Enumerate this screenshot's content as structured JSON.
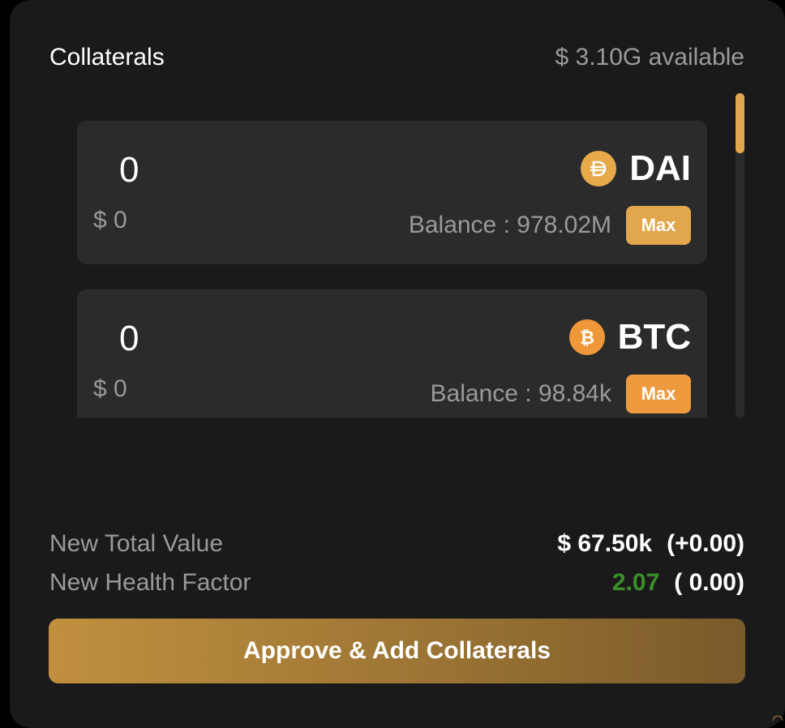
{
  "header": {
    "title": "Collaterals",
    "available": "$ 3.10G available"
  },
  "cards": [
    {
      "amount": "0",
      "usd": "$ 0",
      "token": "DAI",
      "icon": "dai-icon",
      "icon_color": "#e8a94a",
      "balance": "Balance : 978.02M",
      "max_label": "Max",
      "max_color": "#e2a64c"
    },
    {
      "amount": "0",
      "usd": "$ 0",
      "token": "BTC",
      "icon": "btc-icon",
      "icon_color": "#f0973a",
      "balance": "Balance : 98.84k",
      "max_label": "Max",
      "max_color": "#ee9a3e"
    }
  ],
  "summary": {
    "total_label": "New Total Value",
    "total_value": "$ 67.50k",
    "total_change": "(+0.00)",
    "health_label": "New Health Factor",
    "health_value": "2.07",
    "health_change": "( 0.00)"
  },
  "approve_label": "Approve & Add Collaterals",
  "colors": {
    "background": "#1a1a1a",
    "card": "#2b2b2b",
    "accent": "#e2a64c",
    "health_green": "#3a8f2a",
    "muted_text": "#9a9a9a"
  }
}
